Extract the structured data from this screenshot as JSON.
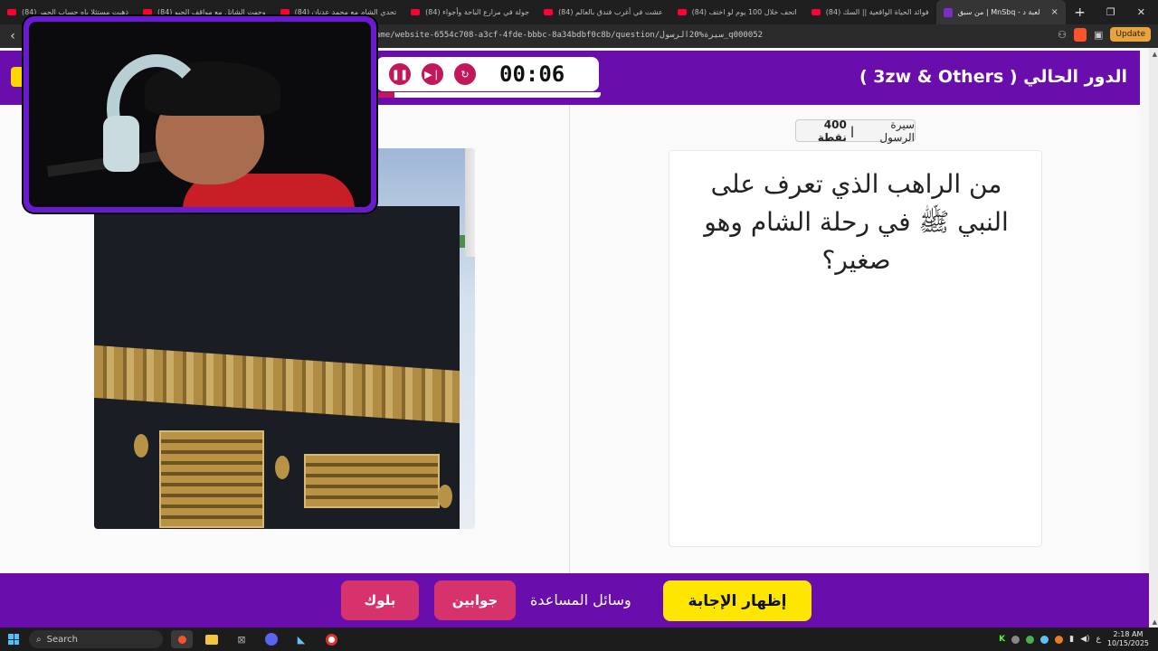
{
  "browser": {
    "tabs": [
      "(84) ذهبت مستثلا ياه حساب الجمر",
      "(84) وجهت الشاتل مع مواقف الجبو",
      "(84) تحدي الشام مع محمد عدنان",
      "(84) جولة في مزارع الباحة وأجواء",
      "(84) عشت في أغرب فندق بالعالم",
      "(84) اتحف خلال 100 يوم لو اختف",
      "(84) فوائد الحياة الواقعية || السك",
      "من سبق | MnSbq - لعبة"
    ],
    "active_tab": "من سبق | MnSbq - لعبة د",
    "url": "ame/website-6554c708-a3cf-4fde-bbbc-8a34bdbf0c8b/question/سيرة%20الرسول_q000052",
    "update_label": "Update",
    "new_tab": "+",
    "close_tab": "×"
  },
  "header": {
    "turn_label": "الدور الحالي ( 3zw & Others )",
    "timer": "00:06",
    "timer_progress": 0.08
  },
  "question": {
    "category": "سيرة الرسول",
    "separator": "|",
    "points": "400 نقطة",
    "text": "من الراهب الذي تعرف على النبي ﷺ في رحلة الشام وهو صغير؟"
  },
  "footer": {
    "reveal_answer": "إظهار الإجابة",
    "help_tools": "وسائل المساعدة",
    "answers": "جوابين",
    "block": "بلوك"
  },
  "taskbar": {
    "search_placeholder": "Search",
    "time": "2:18 AM",
    "date": "10/15/2025",
    "lang": "ع"
  },
  "colors": {
    "brand_purple": "#6a0dad",
    "yellow": "#ffe600",
    "pink": "#d6336c"
  },
  "icons": [
    "pause-icon",
    "skip-icon",
    "restart-icon",
    "search-icon",
    "windows-icon",
    "brave-icon"
  ]
}
